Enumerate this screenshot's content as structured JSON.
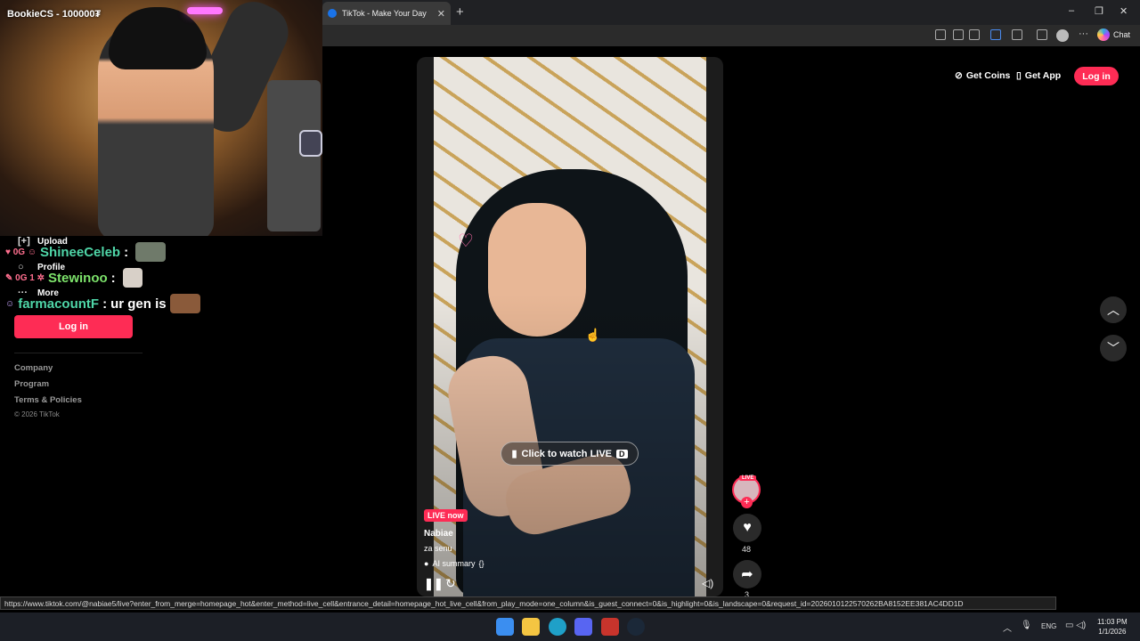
{
  "browser": {
    "tab_title": "TikTok - Make Your Day",
    "new_tab_glyph": "+",
    "chat_label": "Chat",
    "window_controls": [
      "–",
      "❐",
      "✕"
    ]
  },
  "webcam": {
    "streamer_title": "BookieCS - 100000₮"
  },
  "sidebar": {
    "items": [
      {
        "icon": "upload-icon",
        "glyph": "[+]",
        "label": "Upload"
      },
      {
        "icon": "profile-icon",
        "glyph": "○",
        "label": "Profile"
      },
      {
        "icon": "more-icon",
        "glyph": "···",
        "label": "More"
      }
    ],
    "login_label": "Log in",
    "footer": [
      "Company",
      "Program",
      "Terms & Policies"
    ],
    "copyright": "© 2026 TikTok"
  },
  "chat": [
    {
      "badges": "♥ 0G ☺",
      "user": "ShineeCeleb",
      "message": "",
      "emote_color": "#6f7a6a"
    },
    {
      "badges": "✎ 0G 1 ✲",
      "user": "Stewinoo",
      "message": "",
      "emote_color": "#d8d0c8"
    },
    {
      "badges": "☺",
      "user": "farmacountF",
      "message": "ur gen is",
      "emote_color": "#8a5a3a"
    }
  ],
  "header": {
    "get_coins": "Get Coins",
    "get_app": "Get App",
    "login": "Log in"
  },
  "video": {
    "watch_live_label": "Click to watch LIVE",
    "watch_live_key": "D",
    "live_badge": "LIVE now",
    "author": "Nabiae",
    "caption": "za senu",
    "ai_summary": "AI summary",
    "ai_summary_suffix": "{}",
    "live_tag": "LIVE",
    "like_count": "48",
    "share_count": "3"
  },
  "status_url": "https://www.tiktok.com/@nabiae5/live?enter_from_merge=homepage_hot&enter_method=live_cell&entrance_detail=homepage_hot_live_cell&from_play_mode=one_column&is_guest_connect=0&is_highlight=0&is_landscape=0&request_id=2026010122570262BA8152EE381AC4DD1D",
  "taskbar": {
    "language": "ENG",
    "time": "11:03 PM",
    "date": "1/1/2026",
    "apps": [
      {
        "name": "windows-start-icon",
        "color": "#3b8ef0"
      },
      {
        "name": "file-explorer-icon",
        "color": "#f4c542"
      },
      {
        "name": "edge-browser-icon",
        "color": "#1fa0c8"
      },
      {
        "name": "discord-icon",
        "color": "#5865f2"
      },
      {
        "name": "game-launcher-icon",
        "color": "#c8342c"
      },
      {
        "name": "steam-icon",
        "color": "#1b2838"
      }
    ]
  },
  "colors": {
    "accent": "#fe2c55",
    "chat_name_green": "#4fd6a8"
  }
}
